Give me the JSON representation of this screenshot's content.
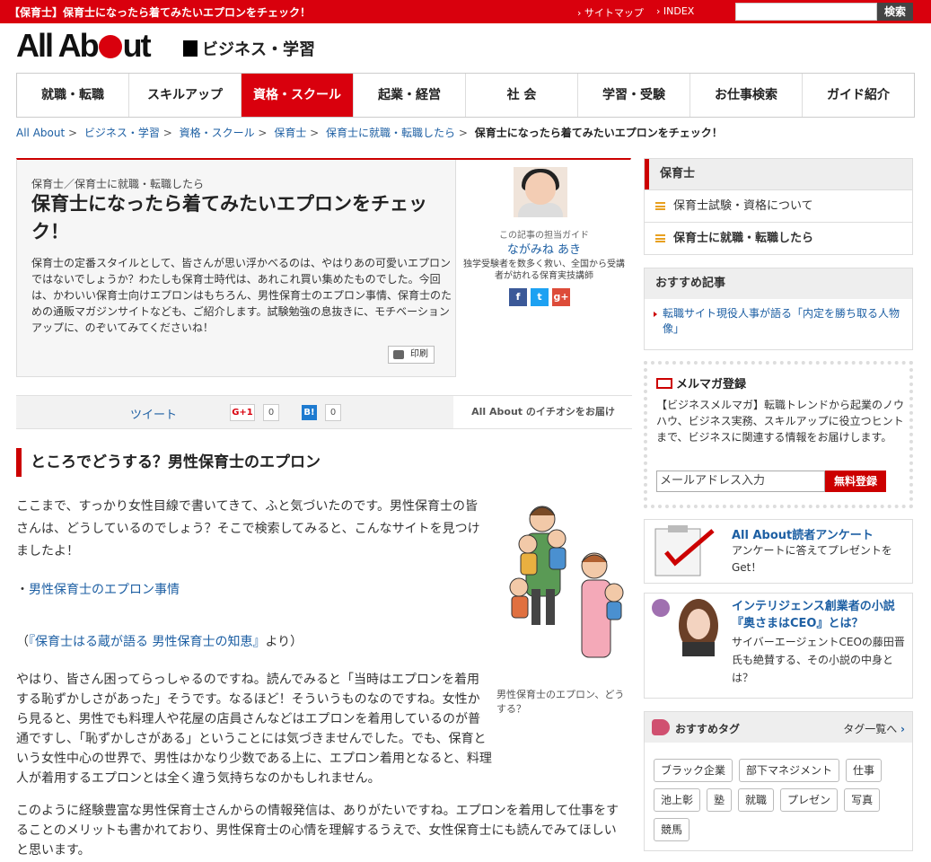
{
  "topbar": {
    "title": "【保育士】保育士になったら着てみたいエプロンをチェック！",
    "links": [
      "サイトマップ",
      "INDEX"
    ],
    "search_button": "検索",
    "search_placeholder": ""
  },
  "logo": {
    "text_a": "All Ab",
    "text_b": "ut"
  },
  "category": "ビジネス・学習",
  "nav": [
    "就職・転職",
    "スキルアップ",
    "資格・スクール",
    "起業・経営",
    "社 会",
    "学習・受験",
    "お仕事検索",
    "ガイド紹介"
  ],
  "breadcrumbs": [
    "All About",
    "ビジネス・学習",
    "資格・スクール",
    "保育士",
    "保育士に就職・転職したら",
    "保育士になったら着てみたいエプロンをチェック！"
  ],
  "article": {
    "subcategory": "保育士／保育士に就職・転職したら",
    "title": "保育士になったら着てみたいエプロンをチェック！",
    "lead": "保育士の定番スタイルとして、皆さんが思い浮かべるのは、やはりあの可愛いエプロンではないでしょうか？わたしも保育士時代は、あれこれ買い集めたものでした。今回は、かわいい保育士向けエプロンはもちろん、男性保育士のエプロン事情、保育士のための通販マガジンサイトなども、ご紹介します。試験勉強の息抜きに、モチベーションアップに、のぞいてみてくださいね！",
    "print": "印刷"
  },
  "guide": {
    "label": "この記事の担当ガイド",
    "name": "ながみね あき",
    "desc": "独学受験者を数多く救い、全国から受講者が訪れる保育実技講師",
    "sns": [
      "f",
      "t",
      "g+"
    ]
  },
  "share": {
    "tweet": "ツイート",
    "gplus": "G+1",
    "gplus_count": "0",
    "hatena": "B!",
    "hatena_count": "0",
    "recommend": "All About のイチオシをお届け"
  },
  "section": {
    "heading": "ところでどうする？男性保育士のエプロン",
    "p1": "ここまで、すっかり女性目線で書いてきて、ふと気づいたのです。男性保育士の皆さんは、どうしているのでしょう？そこで検索してみると、こんなサイトを見つけましたよ！",
    "link": "男性保育士のエプロン事情",
    "src_prefix": "（",
    "src_link": "『保育士はる蔵が語る 男性保育士の知恵』",
    "src_suffix": "より）",
    "p2": "やはり、皆さん困ってらっしゃるのですね。読んでみると「当時はエプロンを着用する恥ずかしさがあった」そうです。なるほど！そういうものなのですね。女性から見ると、男性でも料理人や花屋の店員さんなどはエプロンを着用しているのが普通ですし、「恥ずかしさがある」ということには気づきませんでした。でも、保育という女性中心の世界で、男性はかなり少数である上に、エプロン着用となると、料理人が着用するエプロンとは全く違う気持ちなのかもしれません。",
    "p3": "このように経験豊富な男性保育士さんからの情報発信は、ありがたいですね。エプロンを着用して仕事をすることのメリットも書かれており、男性保育士の心情を理解するうえで、女性保育士にも読んでみてほしいと思います。",
    "caption": "男性保育士のエプロン、どうする？"
  },
  "sidebar": {
    "category_title": "保育士",
    "category_items": [
      "保育士試験・資格について",
      "保育士に就職・転職したら"
    ],
    "recommend_title": "おすすめ記事",
    "recommend_items": [
      "転職サイト現役人事が語る「内定を勝ち取る人物像」"
    ],
    "mail": {
      "title": "メルマガ登録",
      "text": "【ビジネスメルマガ】転職トレンドから起業のノウハウ、ビジネス実務、スキルアップに役立つヒントまで、ビジネスに関連する情報をお届けします。",
      "input": "メールアドレス入力",
      "button": "無料登録"
    },
    "ads": [
      {
        "title": "All About読者アンケート",
        "text": "アンケートに答えてプレゼントをGet！"
      },
      {
        "title": "インテリジェンス創業者の小説『奥さまはCEO』とは？",
        "text": "サイバーエージェントCEOの藤田晋氏も絶賛する、その小説の中身とは？"
      }
    ],
    "tags_title": "おすすめタグ",
    "tags_more": "タグ一覧へ",
    "tags": [
      "ブラック企業",
      "部下マネジメント",
      "仕事",
      "池上彰",
      "塾",
      "就職",
      "プレゼン",
      "写真",
      "競馬"
    ]
  },
  "colors": {
    "brand_red": "#d9000d",
    "link": "#1d5fa3"
  }
}
